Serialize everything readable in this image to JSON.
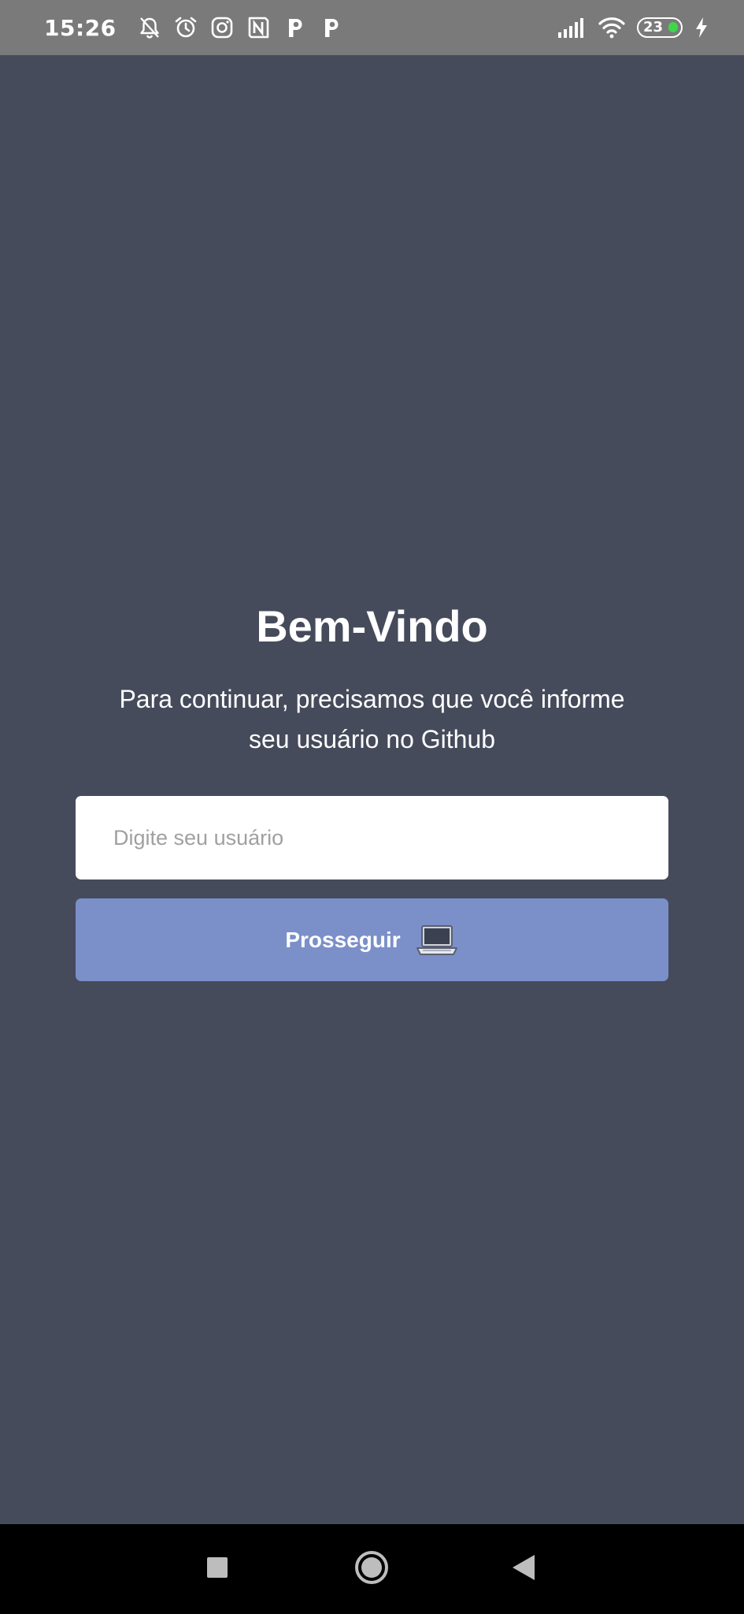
{
  "status_bar": {
    "time": "15:26",
    "notification_icons": [
      "bell-off-icon",
      "alarm-icon",
      "instagram-icon",
      "notion-icon",
      "p-app-icon",
      "p-app-icon"
    ],
    "battery_level": "23",
    "battery_color": "#3fd64a",
    "charging": true
  },
  "welcome": {
    "title": "Bem-Vindo",
    "subtitle": "Para continuar, precisamos que você informe seu usuário no Github"
  },
  "form": {
    "username_placeholder": "Digite seu usuário",
    "username_value": "",
    "proceed_label": "Prosseguir",
    "proceed_icon": "laptop-icon"
  },
  "nav_bar": {
    "buttons": [
      "recents-icon",
      "home-icon",
      "back-icon"
    ]
  },
  "colors": {
    "background": "#464b5b",
    "status_bar": "#7a7a7a",
    "button": "#7b90c9",
    "input": "#ffffff",
    "nav_bar": "#000000"
  }
}
